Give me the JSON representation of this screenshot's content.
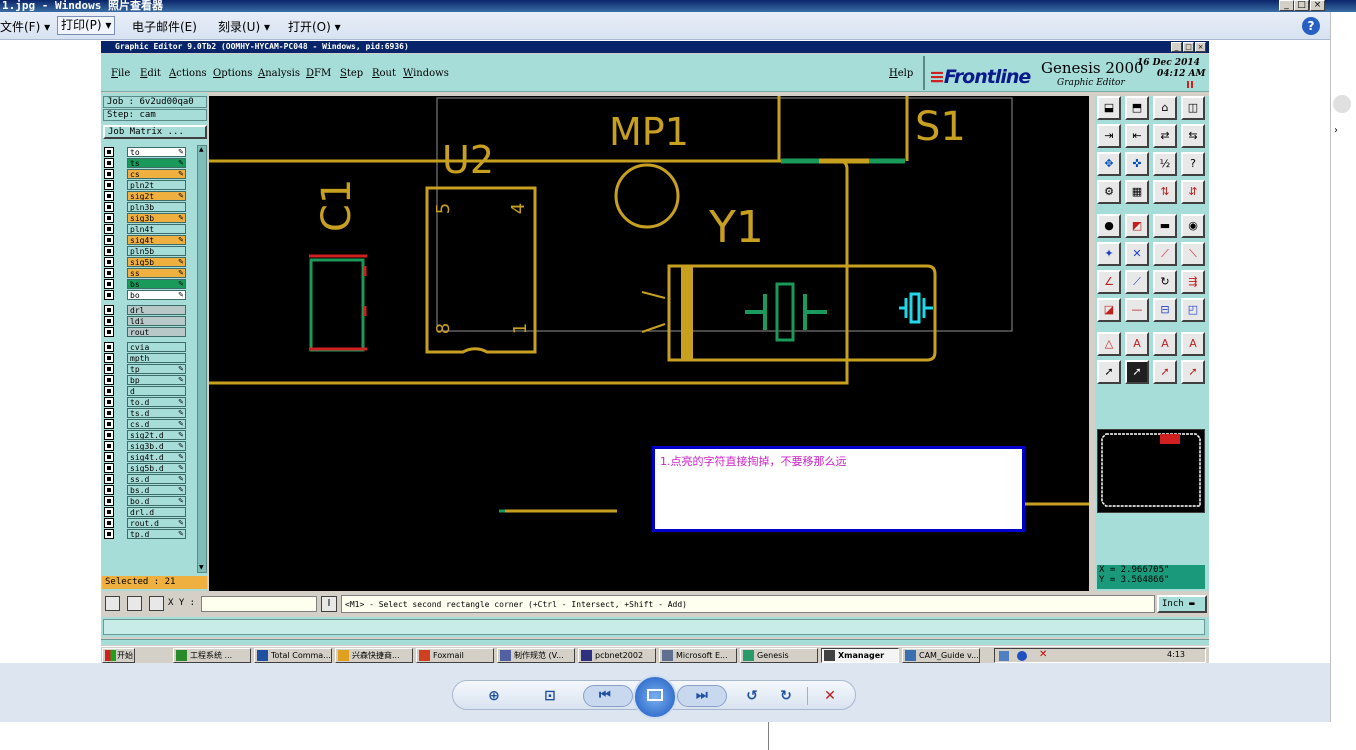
{
  "viewer": {
    "title": "1.jpg - Windows 照片查看器",
    "menu": {
      "file": "文件(F)",
      "print": "打印(P)",
      "email": "电子邮件(E)",
      "burn": "刻录(U)",
      "open": "打开(O)"
    },
    "help_icon": "?"
  },
  "genesis": {
    "title": "Graphic Editor 9.0Tb2 (OOMHY-HYCAM-PC048 - Windows, pid:6936)",
    "menus": [
      "File",
      "Edit",
      "Actions",
      "Options",
      "Analysis",
      "DFM",
      "Step",
      "Rout",
      "Windows"
    ],
    "help": "Help",
    "brand": "Frontline",
    "product": "Genesis 2000",
    "subtitle": "Graphic Editor",
    "date": "16 Dec 2014",
    "time": "04:12 AM",
    "job": "Job : 6v2ud00qa0",
    "step": "Step: cam",
    "job_matrix": "Job Matrix ...",
    "selected": "Selected : 21",
    "layers": [
      {
        "name": "to",
        "color": "#ffffff",
        "edit": true
      },
      {
        "name": "ts",
        "color": "#1a9a5a",
        "edit": true
      },
      {
        "name": "cs",
        "color": "#f0b040",
        "edit": true
      },
      {
        "name": "pln2t",
        "color": "#a7ddd8",
        "edit": false
      },
      {
        "name": "sig2t",
        "color": "#f0b040",
        "edit": true
      },
      {
        "name": "pln3b",
        "color": "#a7ddd8",
        "edit": false
      },
      {
        "name": "sig3b",
        "color": "#f0b040",
        "edit": true
      },
      {
        "name": "pln4t",
        "color": "#a7ddd8",
        "edit": false
      },
      {
        "name": "sig4t",
        "color": "#f0b040",
        "edit": true
      },
      {
        "name": "pln5b",
        "color": "#a7ddd8",
        "edit": false
      },
      {
        "name": "sig5b",
        "color": "#f0b040",
        "edit": true
      },
      {
        "name": "ss",
        "color": "#f0b040",
        "edit": true
      },
      {
        "name": "bs",
        "color": "#1a9a5a",
        "edit": true
      },
      {
        "name": "bo",
        "color": "#ffffff",
        "edit": true
      },
      {
        "name": "drl",
        "color": "#b8c8c8",
        "edit": false
      },
      {
        "name": "ldi",
        "color": "#b8c8c8",
        "edit": false
      },
      {
        "name": "rout",
        "color": "#b8c8c8",
        "edit": false
      },
      {
        "name": "cvia",
        "color": "#a7ddd8",
        "edit": false
      },
      {
        "name": "mpth",
        "color": "#a7ddd8",
        "edit": false
      },
      {
        "name": "tp",
        "color": "#a7ddd8",
        "edit": true
      },
      {
        "name": "bp",
        "color": "#a7ddd8",
        "edit": true
      },
      {
        "name": "d",
        "color": "#a7ddd8",
        "edit": false
      },
      {
        "name": "to.d",
        "color": "#a7ddd8",
        "edit": true
      },
      {
        "name": "ts.d",
        "color": "#a7ddd8",
        "edit": true
      },
      {
        "name": "cs.d",
        "color": "#a7ddd8",
        "edit": true
      },
      {
        "name": "sig2t.d",
        "color": "#a7ddd8",
        "edit": true
      },
      {
        "name": "sig3b.d",
        "color": "#a7ddd8",
        "edit": true
      },
      {
        "name": "sig4t.d",
        "color": "#a7ddd8",
        "edit": true
      },
      {
        "name": "sig5b.d",
        "color": "#a7ddd8",
        "edit": true
      },
      {
        "name": "ss.d",
        "color": "#a7ddd8",
        "edit": true
      },
      {
        "name": "bs.d",
        "color": "#a7ddd8",
        "edit": true
      },
      {
        "name": "bo.d",
        "color": "#a7ddd8",
        "edit": true
      },
      {
        "name": "drl.d",
        "color": "#a7ddd8",
        "edit": false
      },
      {
        "name": "rout.d",
        "color": "#a7ddd8",
        "edit": true
      },
      {
        "name": "tp.d",
        "color": "#a7ddd8",
        "edit": true
      }
    ],
    "canvas_labels": {
      "mp1": "MP1",
      "s1": "S1",
      "u2": "U2",
      "c1": "C1",
      "y1": "Y1",
      "pin5": "5",
      "pin4": "4",
      "pin8": "8",
      "pin1": "1"
    },
    "annotation": "1.点亮的字符直接掏掉，不要移那么远",
    "coords": {
      "x": "X = 2.966705\"",
      "y": "Y = 3.564866\""
    },
    "xy_label": "X Y :",
    "xy_value": "",
    "prompt": "<M1> - Select second rectangle corner (+Ctrl - Intersect, +Shift - Add)",
    "units": "Inch"
  },
  "taskbar": {
    "start": "开始",
    "tasks": [
      "工程系统 ...",
      "Total Comma...",
      "兴森快捷商...",
      "Foxmail",
      "制作规范 (V...",
      "pcbnet2002",
      "Microsoft E...",
      "Genesis",
      "Xmanager",
      "CAM_Guide v..."
    ],
    "active_task": "Xmanager",
    "clock": "4:13"
  },
  "colors": {
    "panel": "#a7ddd8",
    "silk": "#c8a020",
    "copper_green": "#1a9a5a",
    "cyan": "#22d8e8",
    "annotation_text": "#cc22cc",
    "annotation_border": "#0000cc"
  }
}
